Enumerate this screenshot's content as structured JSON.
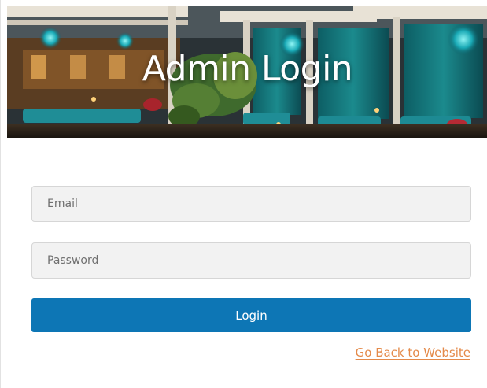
{
  "header": {
    "title": "Admin Login"
  },
  "form": {
    "email_placeholder": "Email",
    "password_placeholder": "Password",
    "login_label": "Login"
  },
  "links": {
    "back_label": "Go Back to Website"
  },
  "colors": {
    "primary_button": "#0d76b5",
    "link": "#e48a4a",
    "input_background": "#f2f2f2"
  }
}
